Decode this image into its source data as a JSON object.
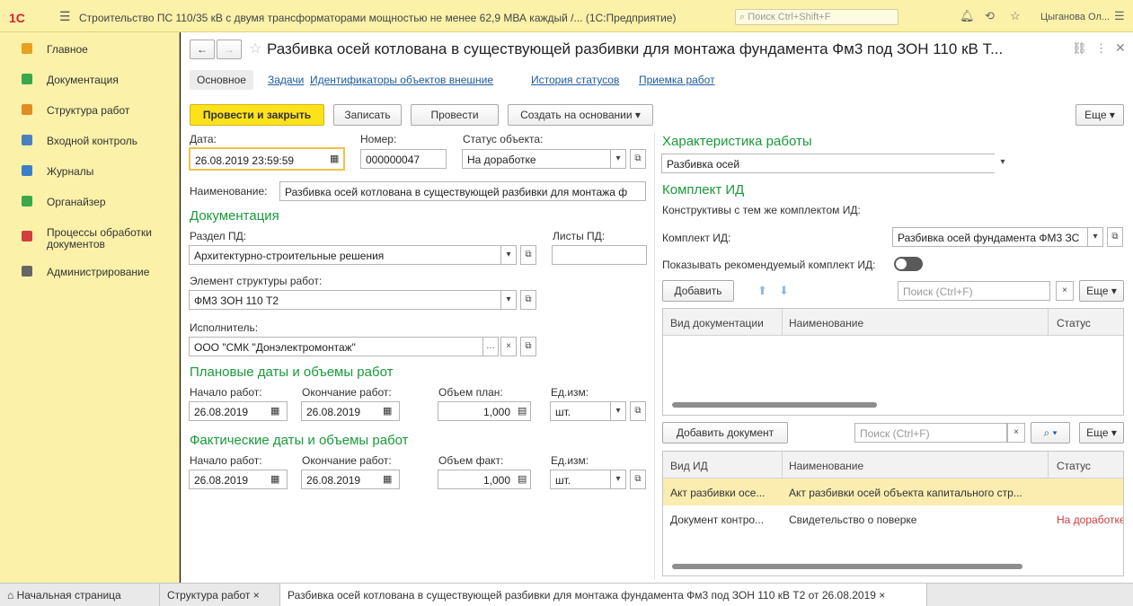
{
  "titlebar": {
    "logo": "1С",
    "title": "Строительство ПС 110/35 кВ с двумя трансформаторами мощностью не менее 62,9 МВА каждый /... (1С:Предприятие)",
    "search_placeholder": "Поиск Ctrl+Shift+F",
    "user": "Цыганова Ол..."
  },
  "sidebar": {
    "items": [
      {
        "label": "Главное",
        "color": "#e8a020"
      },
      {
        "label": "Документация",
        "color": "#3aa84a"
      },
      {
        "label": "Структура работ",
        "color": "#e08c20"
      },
      {
        "label": "Входной контроль",
        "color": "#4a7fc0"
      },
      {
        "label": "Журналы",
        "color": "#3a7fc8"
      },
      {
        "label": "Органайзер",
        "color": "#3aa84a"
      },
      {
        "label": "Процессы обработки документов",
        "color": "#d04040"
      },
      {
        "label": "Администрирование",
        "color": "#666666"
      }
    ]
  },
  "form": {
    "title": "Разбивка осей котлована в существующей разбивки для монтажа фундамента Фм3 под ЗОН 110 кВ Т...",
    "tabs": [
      "Основное",
      "Задачи",
      "Идентификаторы объектов внешние",
      "История статусов",
      "Приемка работ"
    ],
    "toolbar": {
      "post_close": "Провести и закрыть",
      "write": "Записать",
      "post": "Провести",
      "create_based": "Создать на основании",
      "more": "Еще"
    },
    "date_label": "Дата:",
    "date_value": "26.08.2019 23:59:59",
    "number_label": "Номер:",
    "number_value": "000000047",
    "status_label": "Статус объекта:",
    "status_value": "На доработке",
    "name_label": "Наименование:",
    "name_value": "Разбивка осей котлована в существующей разбивки для монтажа ф",
    "doc_section": "Документация",
    "pd_label": "Раздел ПД:",
    "pd_value": "Архитектурно-строительные решения",
    "sheets_label": "Листы ПД:",
    "element_label": "Элемент структуры работ:",
    "element_value": "ФМ3 ЗОН 110 Т2",
    "executor_label": "Исполнитель:",
    "executor_value": "ООО \"СМК \"Донэлектромонтаж\"",
    "planned_section": "Плановые даты и объемы работ",
    "actual_section": "Фактические даты и объемы работ",
    "start_label": "Начало работ:",
    "end_label": "Окончание работ:",
    "vol_plan_label": "Объем план:",
    "vol_fact_label": "Объем факт:",
    "unit_label": "Ед.изм:",
    "start_plan": "26.08.2019",
    "end_plan": "26.08.2019",
    "vol_plan": "1,000",
    "unit_plan": "шт.",
    "start_fact": "26.08.2019",
    "end_fact": "26.08.2019",
    "vol_fact": "1,000",
    "unit_fact": "шт."
  },
  "right": {
    "char_section": "Характеристика работы",
    "char_value": "Разбивка осей",
    "kit_section": "Комплект ИД",
    "constructive_label": "Конструктивы с тем же комплектом ИД:",
    "kit_label": "Комплект ИД:",
    "kit_value": "Разбивка осей фундамента ФМ3 ЗС",
    "show_recommended": "Показывать рекомендуемый комплект ИД:",
    "add": "Добавить",
    "search_placeholder": "Поиск (Ctrl+F)",
    "more": "Еще",
    "grid1_headers": [
      "Вид документации",
      "Наименование",
      "Статус"
    ],
    "add_document": "Добавить документ",
    "grid2_headers": [
      "Вид ИД",
      "Наименование",
      "Статус"
    ],
    "grid2_rows": [
      {
        "kind": "Акт разбивки осе...",
        "name": "Акт разбивки осей объекта капитального стр...",
        "status": ""
      },
      {
        "kind": "Документ контро...",
        "name": "Свидетельство о поверке",
        "status": "На доработке"
      }
    ]
  },
  "bottom_tabs": {
    "home": "Начальная страница",
    "t1": "Структура работ",
    "t2": "Разбивка осей котлована в существующей разбивки для монтажа фундамента Фм3 под ЗОН 110 кВ Т2 от 26.08.2019"
  }
}
